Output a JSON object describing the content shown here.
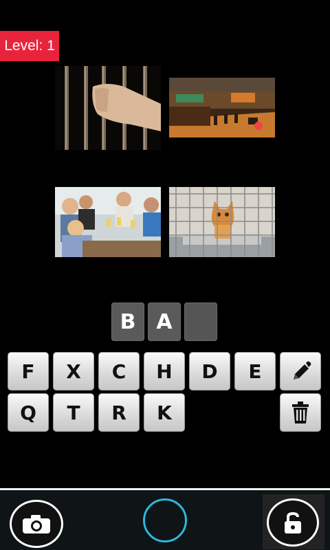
{
  "level": {
    "text": "Level: 1",
    "color": "#e8243c"
  },
  "photos": [
    {
      "subject": "hands gripping prison bars"
    },
    {
      "subject": "restaurant bar interior"
    },
    {
      "subject": "friends toasting drinks at table"
    },
    {
      "subject": "cat inside wire cage"
    }
  ],
  "answer": {
    "slots": [
      "B",
      "A",
      ""
    ]
  },
  "keyboard": {
    "row1": [
      "F",
      "X",
      "C",
      "H",
      "D",
      "E"
    ],
    "row2": [
      "Q",
      "T",
      "R",
      "K"
    ],
    "pencil_icon": "pencil-icon",
    "trash_icon": "trash-icon"
  },
  "bottom_bar": {
    "camera_icon": "camera-icon",
    "unlock_icon": "unlock-icon",
    "accent_color": "#2bb9df"
  }
}
